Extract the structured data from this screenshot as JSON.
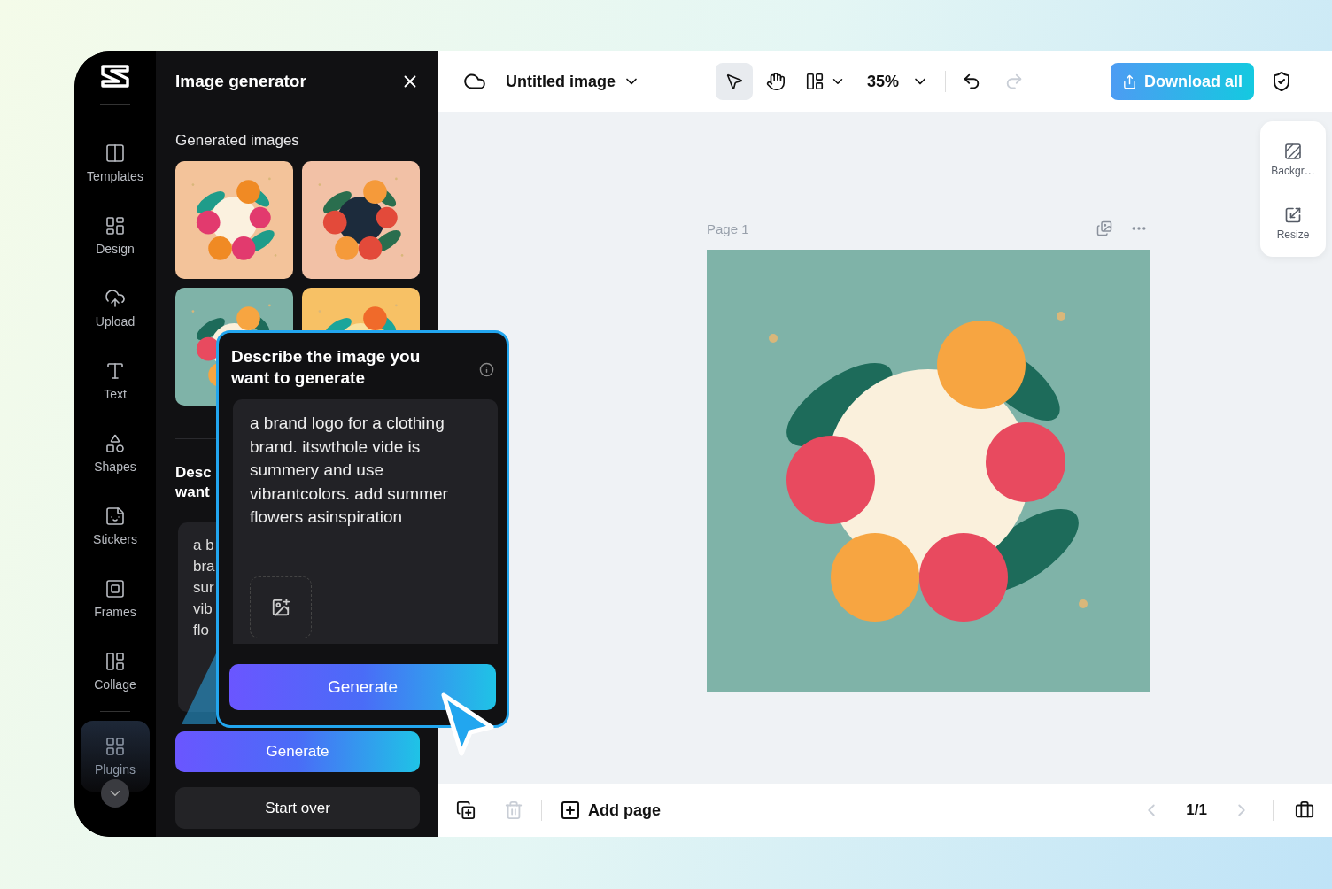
{
  "sidebar": {
    "items": [
      {
        "label": "Templates",
        "selected": false
      },
      {
        "label": "Design",
        "selected": false
      },
      {
        "label": "Upload",
        "selected": false
      },
      {
        "label": "Text",
        "selected": false
      },
      {
        "label": "Shapes",
        "selected": false
      },
      {
        "label": "Stickers",
        "selected": false
      },
      {
        "label": "Frames",
        "selected": false
      },
      {
        "label": "Collage",
        "selected": false
      },
      {
        "label": "Plugins",
        "selected": true
      }
    ]
  },
  "panel": {
    "title": "Image generator",
    "section_title": "Generated images",
    "prompt_title_lines": [
      "Desc",
      "want"
    ],
    "prompt_lines": [
      "a b",
      "bra",
      "sur",
      "vib",
      "flo"
    ],
    "generate_button": "Generate",
    "start_over_button": "Start over"
  },
  "popup": {
    "title": "Describe the image you want to generate",
    "prompt": "a brand logo for a clothing brand. itswthole vide is summery and use vibrantcolors. add summer flowers asinspiration",
    "generate_button": "Generate"
  },
  "toolbar": {
    "document_title": "Untitled image",
    "tools": [
      {
        "kind": "select",
        "selected": true
      },
      {
        "kind": "hand",
        "selected": false
      }
    ],
    "zoom": "35%",
    "redo_disabled": true,
    "download_button": "Download all"
  },
  "canvas": {
    "page_label": "Page 1"
  },
  "side_tools": [
    {
      "label": "Backgr…",
      "kind": "background"
    },
    {
      "label": "Resize",
      "kind": "resize"
    }
  ],
  "bottom_bar": {
    "delete_disabled": true,
    "add_page_button": "Add page",
    "page_counter": "1/1",
    "prev_disabled": true,
    "next_disabled": true
  }
}
